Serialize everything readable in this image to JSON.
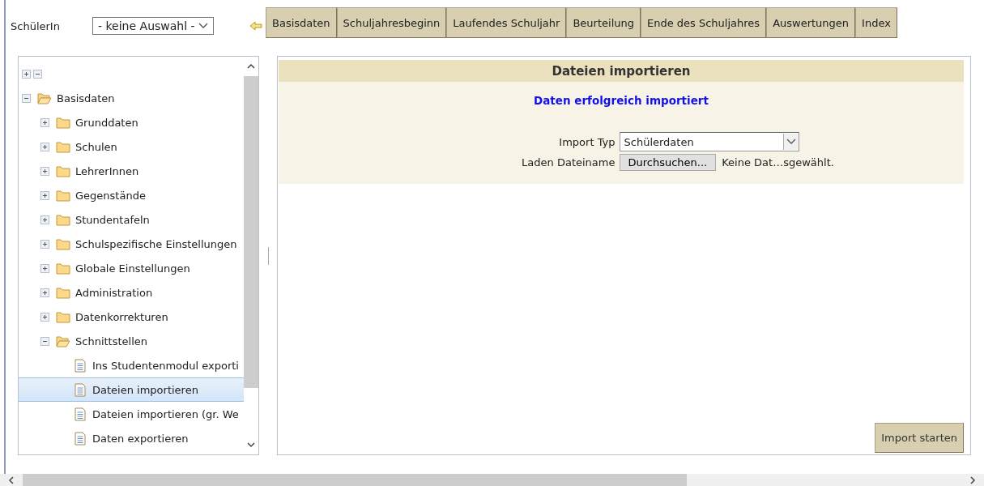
{
  "student_filter": {
    "label": "SchülerIn",
    "value": "- keine Auswahl -"
  },
  "nav_tabs": [
    {
      "label": "Basisdaten",
      "selected": false
    },
    {
      "label": "Schuljahresbeginn",
      "selected": false
    },
    {
      "label": "Laufendes Schuljahr",
      "selected": false
    },
    {
      "label": "Beurteilung",
      "selected": false
    },
    {
      "label": "Ende des Schuljahres",
      "selected": false
    },
    {
      "label": "Auswertungen",
      "selected": false
    },
    {
      "label": "Index",
      "selected": false
    }
  ],
  "tree": [
    {
      "label": "Basisdaten",
      "kind": "folder",
      "expanded": true,
      "selected": false,
      "children": [
        {
          "label": "Grunddaten",
          "kind": "folder",
          "expanded": false,
          "selected": false
        },
        {
          "label": "Schulen",
          "kind": "folder",
          "expanded": false,
          "selected": false
        },
        {
          "label": "LehrerInnen",
          "kind": "folder",
          "expanded": false,
          "selected": false
        },
        {
          "label": "Gegenstände",
          "kind": "folder",
          "expanded": false,
          "selected": false
        },
        {
          "label": "Stundentafeln",
          "kind": "folder",
          "expanded": false,
          "selected": false
        },
        {
          "label": "Schulspezifische Einstellungen",
          "kind": "folder",
          "expanded": false,
          "selected": false
        },
        {
          "label": "Globale Einstellungen",
          "kind": "folder",
          "expanded": false,
          "selected": false
        },
        {
          "label": "Administration",
          "kind": "folder",
          "expanded": false,
          "selected": false
        },
        {
          "label": "Datenkorrekturen",
          "kind": "folder",
          "expanded": false,
          "selected": false
        },
        {
          "label": "Schnittstellen",
          "kind": "folder",
          "expanded": true,
          "selected": false,
          "children": [
            {
              "label": "Ins Studentenmodul exporti",
              "kind": "file",
              "selected": false
            },
            {
              "label": "Dateien importieren",
              "kind": "file",
              "selected": true
            },
            {
              "label": "Dateien importieren (gr. We",
              "kind": "file",
              "selected": false
            },
            {
              "label": "Daten exportieren",
              "kind": "file",
              "selected": false
            }
          ]
        }
      ]
    }
  ],
  "panel": {
    "title": "Dateien importieren",
    "message": "Daten erfolgreich importiert",
    "import_type": {
      "label": "Import Typ",
      "value": "Schülerdaten"
    },
    "file": {
      "label": "Laden Dateiname",
      "button": "Durchsuchen...",
      "status": "Keine Dat…sgewählt."
    },
    "submit": "Import starten"
  }
}
